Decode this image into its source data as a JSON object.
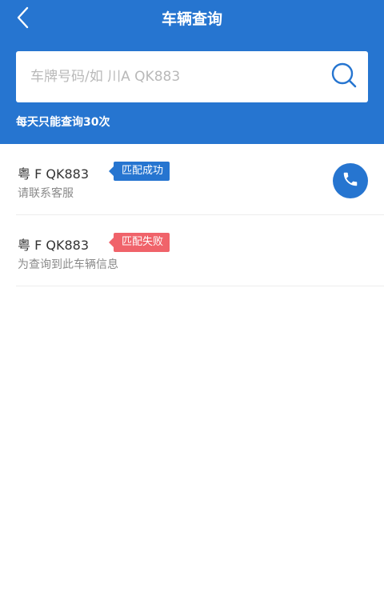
{
  "header": {
    "title": "车辆查询",
    "back_icon": "back-arrow-icon"
  },
  "search": {
    "placeholder": "车牌号码/如 川A QK883",
    "value": "",
    "icon": "search-icon"
  },
  "limit_note": "每天只能查询30次",
  "results": [
    {
      "plate": "粤 F QK883",
      "status": "匹配成功",
      "status_color": "#2675d0",
      "message": "请联系客服",
      "action_icon": "phone-icon"
    },
    {
      "plate": "粤 F QK883",
      "status": "匹配失败",
      "status_color": "#f0636a",
      "message": "为查询到此车辆信息"
    }
  ],
  "colors": {
    "primary": "#2675d0",
    "danger": "#f0636a"
  }
}
